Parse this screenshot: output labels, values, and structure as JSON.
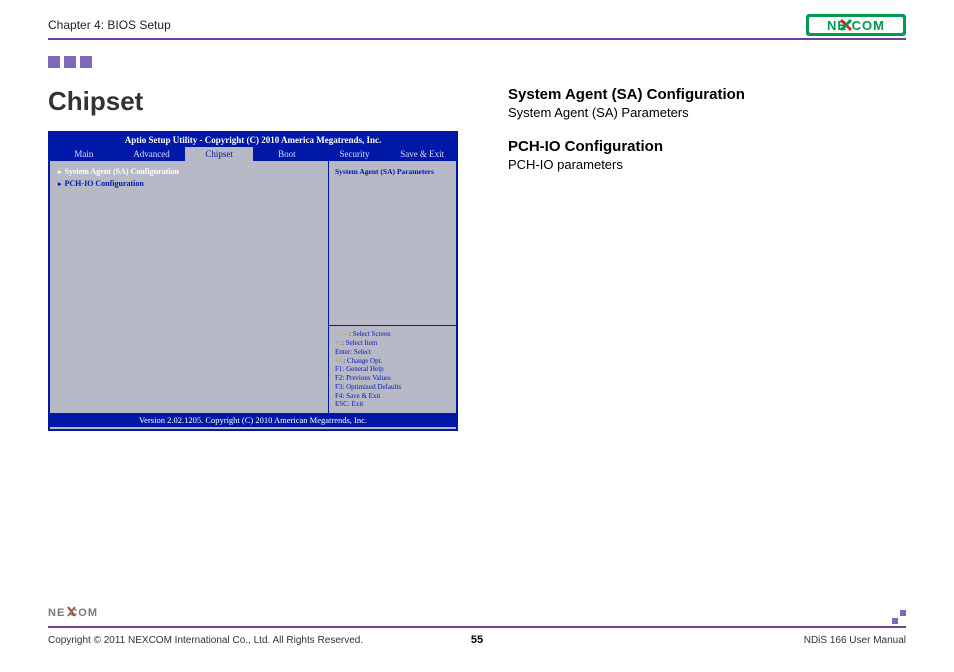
{
  "header": {
    "chapter": "Chapter 4: BIOS Setup"
  },
  "brand": {
    "name": "NEXCOM"
  },
  "left": {
    "title": "Chipset"
  },
  "bios": {
    "title": "Aptio Setup Utility - Copyright (C) 2010 America Megatrends, Inc.",
    "tabs": [
      "Main",
      "Advanced",
      "Chipset",
      "Boot",
      "Security",
      "Save & Exit"
    ],
    "active_tab": "Chipset",
    "items": [
      "System Agent (SA) Configuration",
      "PCH-IO Configuration"
    ],
    "help_text": "System Agent (SA) Parameters",
    "nav": [
      {
        "k": "→←",
        "v": ": Select Screen"
      },
      {
        "k": "↑↓",
        "v": ": Select Item"
      },
      {
        "k": "Enter",
        "v": ": Select"
      },
      {
        "k": "+/-",
        "v": ": Change Opt."
      },
      {
        "k": "F1",
        "v": ": General Help"
      },
      {
        "k": "F2",
        "v": ": Previous Values"
      },
      {
        "k": "F3",
        "v": ": Optimized Defaults"
      },
      {
        "k": "F4",
        "v": ": Save & Exit"
      },
      {
        "k": "ESC",
        "v": ": Exit"
      }
    ],
    "footer": "Version 2.02.1205. Copyright (C) 2010 American Megatrends, Inc."
  },
  "right": {
    "sections": [
      {
        "heading": "System Agent (SA) Configuration",
        "body": "System Agent (SA) Parameters"
      },
      {
        "heading": "PCH-IO Configuration",
        "body": "PCH-IO parameters"
      }
    ]
  },
  "footer": {
    "copyright": "Copyright © 2011 NEXCOM International Co., Ltd. All Rights Reserved.",
    "page": "55",
    "manual": "NDiS 166 User Manual"
  }
}
